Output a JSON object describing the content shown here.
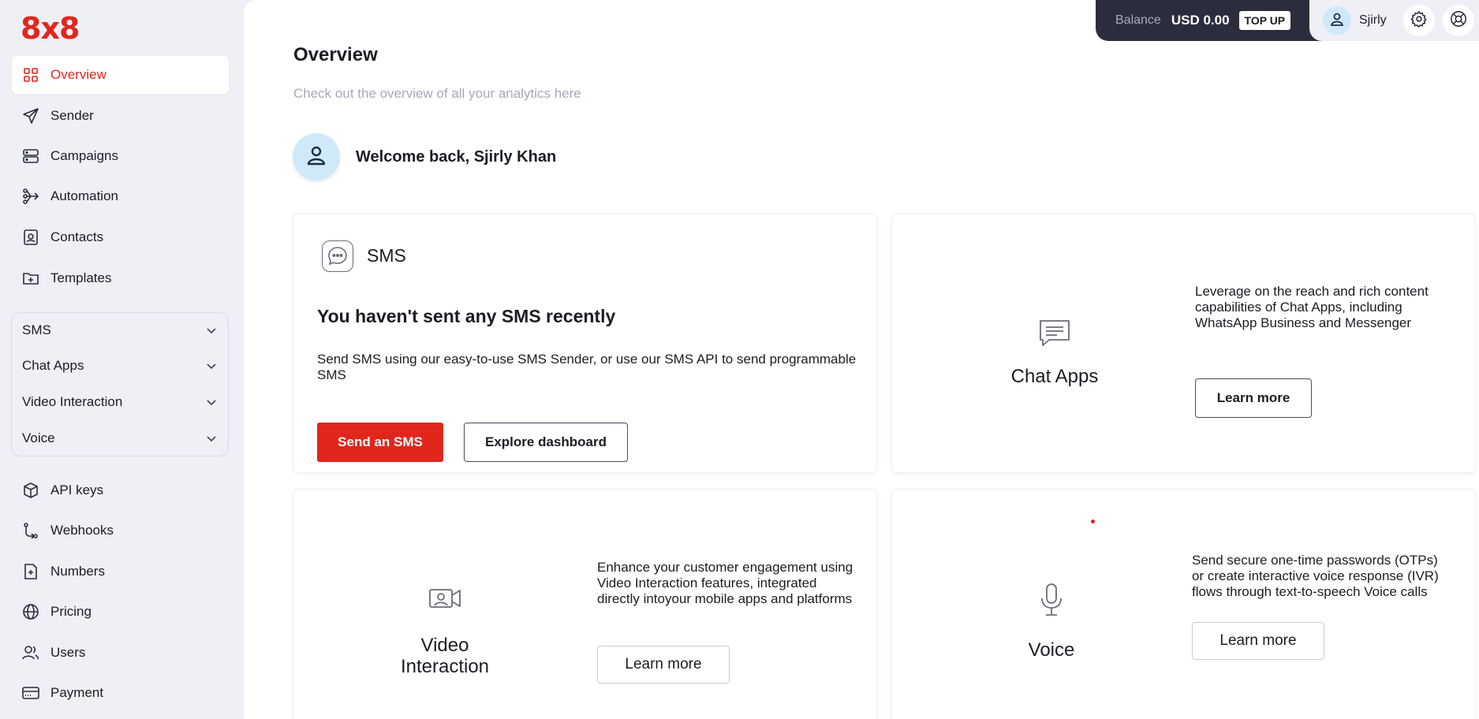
{
  "brand": {
    "logo": "8x8",
    "accent": "#e1261c"
  },
  "sidebar": {
    "nav": [
      {
        "label": "Overview",
        "icon": "grid-icon",
        "active": true
      },
      {
        "label": "Sender",
        "icon": "send-icon"
      },
      {
        "label": "Campaigns",
        "icon": "campaigns-icon"
      },
      {
        "label": "Automation",
        "icon": "automation-icon"
      },
      {
        "label": "Contacts",
        "icon": "contacts-icon"
      },
      {
        "label": "Templates",
        "icon": "templates-icon"
      }
    ],
    "groups": [
      {
        "label": "SMS"
      },
      {
        "label": "Chat Apps"
      },
      {
        "label": "Video Interaction"
      },
      {
        "label": "Voice"
      }
    ],
    "bottom": [
      {
        "label": "API keys",
        "icon": "api-keys-icon"
      },
      {
        "label": "Webhooks",
        "icon": "webhooks-icon"
      },
      {
        "label": "Numbers",
        "icon": "numbers-icon"
      },
      {
        "label": "Pricing",
        "icon": "globe-icon"
      },
      {
        "label": "Users",
        "icon": "users-icon"
      },
      {
        "label": "Payment",
        "icon": "payment-icon"
      }
    ]
  },
  "topbar": {
    "balance_label": "Balance",
    "balance_value": "USD 0.00",
    "topup_label": "TOP UP",
    "user_name": "Sjirly"
  },
  "main": {
    "title": "Overview",
    "subtitle": "Check out the overview of all your analytics here",
    "welcome": "Welcome back, Sjirly Khan"
  },
  "cards": {
    "sms": {
      "title": "SMS",
      "heading": "You haven't sent any SMS recently",
      "description": "Send SMS using our easy-to-use SMS Sender, or use our SMS API to send programmable SMS",
      "primary_label": "Send an SMS",
      "secondary_label": "Explore dashboard"
    },
    "chat_apps": {
      "title": "Chat Apps",
      "description": "Leverage on the reach and rich content capabilities of Chat Apps, including WhatsApp Business and Messenger",
      "button_label": "Learn more"
    },
    "video": {
      "title_line1": "Video",
      "title_line2": "Interaction",
      "description": "Enhance your customer engagement using Video Interaction features, integrated directly intoyour mobile apps and platforms",
      "button_label": "Learn more"
    },
    "voice": {
      "title": "Voice",
      "description": "Send secure one-time passwords (OTPs) or create interactive voice response (IVR) flows through text-to-speech Voice calls",
      "button_label": "Learn more"
    }
  }
}
